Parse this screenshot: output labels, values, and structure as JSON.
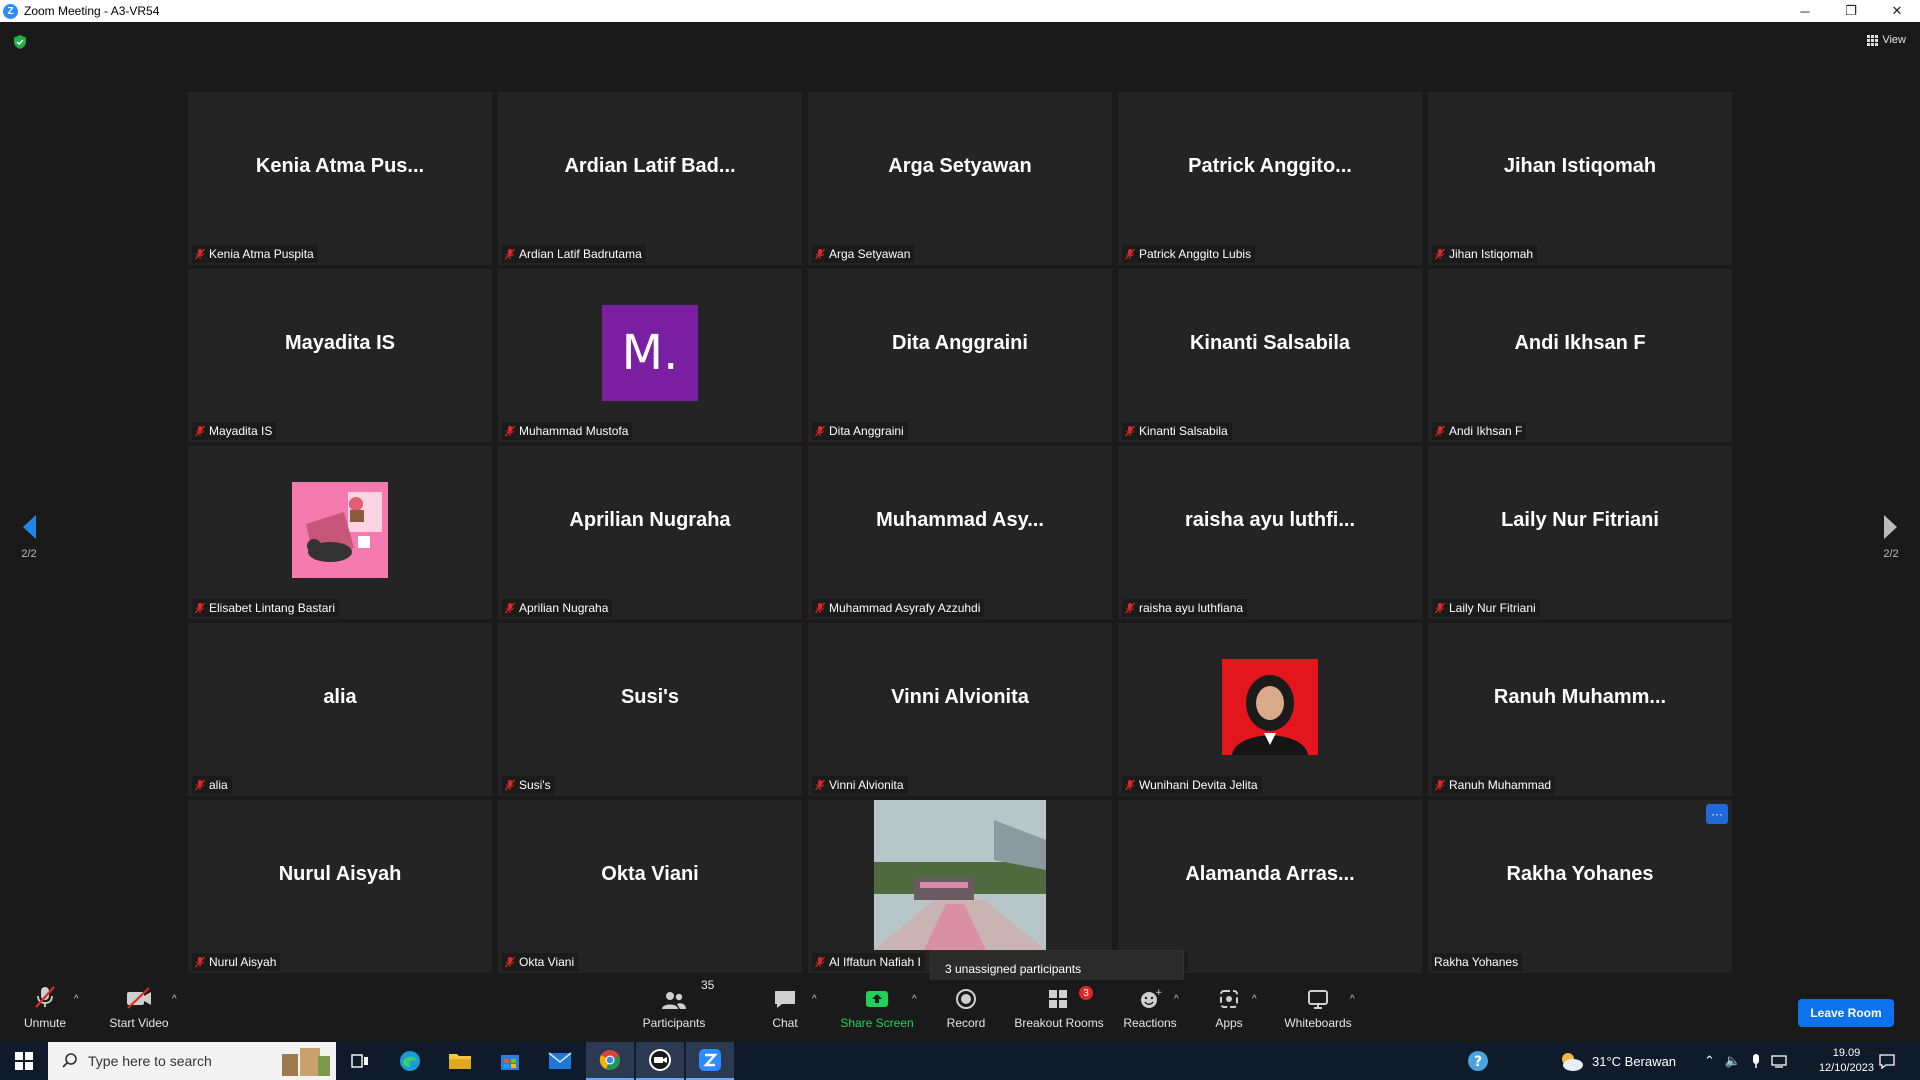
{
  "window": {
    "title": "Zoom Meeting - A3-VR54",
    "app_icon_letter": "Z",
    "minimize": "─",
    "restore": "❐",
    "close": "✕"
  },
  "meeting": {
    "view_label": "View",
    "page_left": "2/2",
    "page_right": "2/2",
    "tooltip": "3 unassigned participants"
  },
  "tiles": [
    {
      "big": "Kenia  Atma  Pus...",
      "caption": "Kenia Atma Puspita",
      "muted": true
    },
    {
      "big": "Ardian  Latif  Bad...",
      "caption": "Ardian Latif Badrutama",
      "muted": true
    },
    {
      "big": "Arga  Setyawan",
      "caption": "Arga Setyawan",
      "muted": true
    },
    {
      "big": "Patrick  Anggito...",
      "caption": "Patrick Anggito Lubis",
      "muted": true
    },
    {
      "big": "Jihan  Istiqomah",
      "caption": "Jihan Istiqomah",
      "muted": true
    },
    {
      "big": "Mayadita  IS",
      "caption": "Mayadita IS",
      "muted": true
    },
    {
      "big": "",
      "avatar_letter": "M.",
      "caption": "Muhammad Mustofa",
      "muted": true
    },
    {
      "big": "Dita  Anggraini",
      "caption": "Dita Anggraini",
      "muted": true
    },
    {
      "big": "Kinanti  Salsabila",
      "caption": "Kinanti Salsabila",
      "muted": true
    },
    {
      "big": "Andi  Ikhsan  F",
      "caption": "Andi Ikhsan F",
      "muted": true
    },
    {
      "big": "",
      "avatar_image": "cat-illustration",
      "caption": "Elisabet Lintang Bastari",
      "muted": true
    },
    {
      "big": "Aprilian  Nugraha",
      "caption": "Aprilian Nugraha",
      "muted": true
    },
    {
      "big": "Muhammad  Asy...",
      "caption": "Muhammad Asyrafy Azzuhdi",
      "muted": true
    },
    {
      "big": "raisha  ayu  luthfi...",
      "caption": "raisha ayu luthfiana",
      "muted": true
    },
    {
      "big": "Laily  Nur  Fitriani",
      "caption": "Laily Nur Fitriani",
      "muted": true
    },
    {
      "big": "alia",
      "caption": "alia",
      "muted": true
    },
    {
      "big": "Susi's",
      "caption": "Susi's",
      "muted": true
    },
    {
      "big": "Vinni  Alvionita",
      "caption": "Vinni Alvionita",
      "muted": true
    },
    {
      "big": "",
      "avatar_image": "portrait-photo",
      "caption": "Wunihani Devita Jelita",
      "muted": true
    },
    {
      "big": "Ranuh  Muhamm...",
      "caption": "Ranuh Muhammad",
      "muted": true
    },
    {
      "big": "Nurul  Aisyah",
      "caption": "Nurul Aisyah",
      "muted": true
    },
    {
      "big": "Okta  Viani",
      "caption": "Okta Viani",
      "muted": true
    },
    {
      "big": "",
      "avatar_image": "landscape-photo",
      "caption": "Al Iffatun Nafiah I",
      "muted": true
    },
    {
      "big": "Alamanda  Arras...",
      "caption": "da Arrasyid",
      "muted": false
    },
    {
      "big": "Rakha  Yohanes",
      "caption": "Rakha Yohanes",
      "muted": false,
      "more_button": "···"
    }
  ],
  "toolbar": {
    "unmute": "Unmute",
    "start_video": "Start Video",
    "participants": "Participants",
    "participants_count": "35",
    "chat": "Chat",
    "share_screen": "Share Screen",
    "record": "Record",
    "breakout_rooms": "Breakout Rooms",
    "breakout_badge": "3",
    "reactions": "Reactions",
    "apps": "Apps",
    "whiteboards": "Whiteboards",
    "leave_room": "Leave Room",
    "caret": "^"
  },
  "taskbar": {
    "search_placeholder": "Type here to search",
    "weather": "31°C  Berawan",
    "time": "19.09",
    "date": "12/10/2023"
  },
  "colors": {
    "accent": "#0e72ed",
    "share_green": "#1fd15b",
    "muted_red": "#e02828",
    "tile_bg": "#242424",
    "avatar_purple": "#7a1fa2"
  }
}
